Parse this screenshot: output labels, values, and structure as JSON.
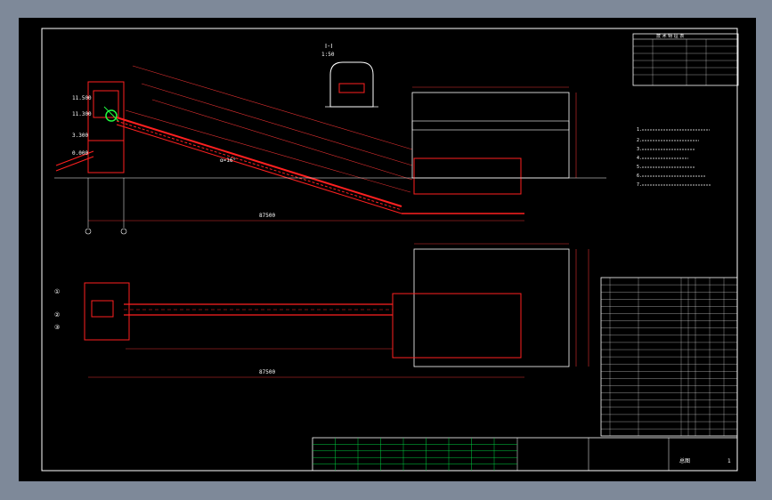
{
  "colors": {
    "background": "#7e8999",
    "canvas": "#000000",
    "frame": "#ffffff",
    "structure": "#ff2020",
    "dimension": "#e03030",
    "grid": "#00d040",
    "text": "#ffffff",
    "highlight": "#20ff40"
  },
  "section": {
    "title": "Ⅰ-Ⅰ",
    "scale": "1:50"
  },
  "elevations": {
    "e1": "11.500",
    "e2": "11.300",
    "e3": "3.300",
    "e4": "0.000"
  },
  "tech_table": {
    "title": "技 术 特 征 表"
  },
  "axis_labels": {
    "a1": "①",
    "a2": "②",
    "a3": "③"
  },
  "slope_label": "α=16°",
  "overall_length": "87500",
  "notes": {
    "n1": "1.",
    "n2": "2.",
    "n3": "3.",
    "n4": "4.",
    "n5": "5.",
    "n6": "6.",
    "n7": "7."
  },
  "title_block": {
    "drawing_name": "总图",
    "sheet": "1"
  }
}
